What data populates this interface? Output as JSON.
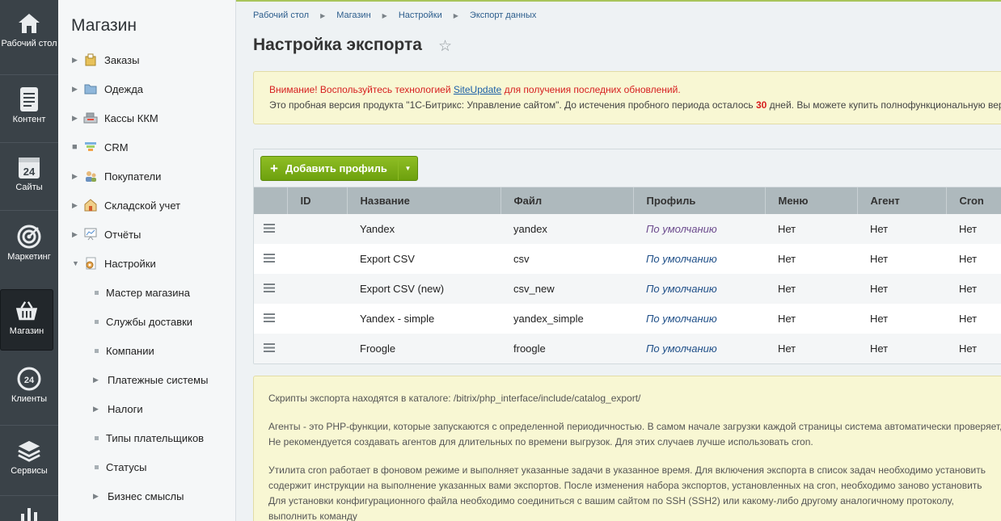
{
  "leftbar": {
    "items": [
      {
        "label": "Рабочий стол",
        "icon": "home-icon"
      },
      {
        "label": "Контент",
        "icon": "document-icon"
      },
      {
        "label": "Сайты",
        "icon": "calendar-24-icon"
      },
      {
        "label": "Маркетинг",
        "icon": "target-icon"
      },
      {
        "label": "Магазин",
        "icon": "basket-icon"
      },
      {
        "label": "Клиенты",
        "icon": "clients-24-icon"
      },
      {
        "label": "Сервисы",
        "icon": "layers-icon"
      }
    ]
  },
  "sidebar": {
    "title": "Магазин",
    "items": [
      {
        "label": "Заказы",
        "icon": "orders-icon"
      },
      {
        "label": "Одежда",
        "icon": "folder-icon"
      },
      {
        "label": "Кассы ККМ",
        "icon": "cash-register-icon"
      },
      {
        "label": "CRM",
        "icon": "crm-funnel-icon"
      },
      {
        "label": "Покупатели",
        "icon": "customers-icon"
      },
      {
        "label": "Складской учет",
        "icon": "warehouse-icon"
      },
      {
        "label": "Отчёты",
        "icon": "reports-icon"
      },
      {
        "label": "Настройки",
        "icon": "settings-icon"
      }
    ],
    "subitems": [
      {
        "label": "Мастер магазина"
      },
      {
        "label": "Службы доставки"
      },
      {
        "label": "Компании"
      },
      {
        "label": "Платежные системы"
      },
      {
        "label": "Налоги"
      },
      {
        "label": "Типы плательщиков"
      },
      {
        "label": "Статусы"
      },
      {
        "label": "Бизнес смыслы"
      }
    ]
  },
  "breadcrumbs": [
    "Рабочий стол",
    "Магазин",
    "Настройки",
    "Экспорт данных"
  ],
  "page": {
    "title": "Настройка экспорта"
  },
  "notice": {
    "line1_prefix": "Внимание! Воспользуйтесь технологией ",
    "link": "SiteUpdate",
    "line1_suffix": " для получения последних обновлений.",
    "line2_prefix": "Это пробная версия продукта \"1С-Битрикс: Управление сайтом\". До истечения пробного периода осталось ",
    "days": "30",
    "line2_suffix": " дней. Вы можете купить полнофункциональную версию продукта."
  },
  "grid": {
    "add_button": "Добавить профиль",
    "columns": [
      "ID",
      "Название",
      "Файл",
      "Профиль",
      "Меню",
      "Агент",
      "Cron"
    ],
    "rows": [
      {
        "id": "",
        "name": "Yandex",
        "file": "yandex",
        "profile": "По умолчанию",
        "menu": "Нет",
        "agent": "Нет",
        "cron": "Нет"
      },
      {
        "id": "",
        "name": "Export CSV",
        "file": "csv",
        "profile": "По умолчанию",
        "menu": "Нет",
        "agent": "Нет",
        "cron": "Нет"
      },
      {
        "id": "",
        "name": "Export CSV (new)",
        "file": "csv_new",
        "profile": "По умолчанию",
        "menu": "Нет",
        "agent": "Нет",
        "cron": "Нет"
      },
      {
        "id": "",
        "name": "Yandex - simple",
        "file": "yandex_simple",
        "profile": "По умолчанию",
        "menu": "Нет",
        "agent": "Нет",
        "cron": "Нет"
      },
      {
        "id": "",
        "name": "Froogle",
        "file": "froogle",
        "profile": "По умолчанию",
        "menu": "Нет",
        "agent": "Нет",
        "cron": "Нет"
      }
    ]
  },
  "info": {
    "p1": "Скрипты экспорта находятся в каталоге: /bitrix/php_interface/include/catalog_export/",
    "p2_l1": "Агенты - это PHP-функции, которые запускаются с определенной периодичностью. В самом начале загрузки каждой страницы система автоматически проверяет,",
    "p2_l2": "Не рекомендуется создавать агентов для длительных по времени выгрузок. Для этих случаев лучше использовать cron.",
    "p3_l1": "Утилита cron работает в фоновом режиме и выполняет указанные задачи в указанное время. Для включения экспорта в список задач необходимо установить",
    "p3_l2": "содержит инструкции на выполнение указанных вами экспортов. После изменения набора экспортов, установленных на cron, необходимо заново установить",
    "p3_l3": "Для установки конфигурационного файла необходимо соединиться с вашим сайтом по SSH (SSH2) или какому-либо другому аналогичному протоколу,",
    "p3_l4": "выполнить команду"
  },
  "colors": {
    "accent_green": "#7aae16",
    "link_blue": "#1f4f88",
    "warn_red": "#d61e1e",
    "leftbar": "#3a4248"
  }
}
